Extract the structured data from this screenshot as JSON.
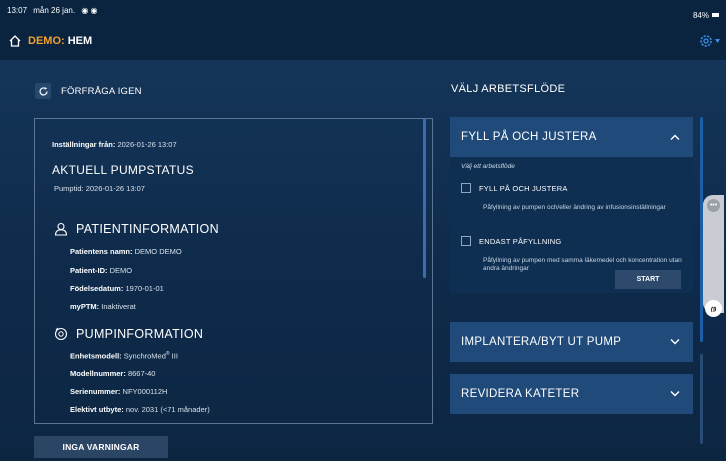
{
  "status_bar": {
    "time": "13:07",
    "date": "mån 26 jan.",
    "battery": "84%"
  },
  "header": {
    "demo": "DEMO:",
    "title": "HEM"
  },
  "refresh": {
    "label": "FÖRFRÅGA IGEN"
  },
  "status": {
    "settings_from_label": "Inställningar från:",
    "settings_from_value": "2026-01-26 13:07",
    "heading": "AKTUELL PUMPSTATUS",
    "pump_time_label": "Pumptid:",
    "pump_time_value": "2026-01-26 13:07"
  },
  "patient": {
    "heading": "PATIENTINFORMATION",
    "name_label": "Patientens namn:",
    "name_value": "DEMO DEMO",
    "id_label": "Patient-ID:",
    "id_value": "DEMO",
    "dob_label": "Födelsedatum:",
    "dob_value": "1970-01-01",
    "myptm_label": "myPTM:",
    "myptm_value": "Inaktiverat"
  },
  "pump": {
    "heading": "PUMPINFORMATION",
    "device_label": "Enhetsmodell:",
    "device_value": "SynchroMed",
    "device_mark": "®",
    "device_suffix": " III",
    "model_label": "Modellnummer:",
    "model_value": "8667-40",
    "serial_label": "Serienummer:",
    "serial_value": "NFY000112H",
    "elective_label": "Elektivt utbyte:",
    "elective_value": "nov. 2031 (<71 månader)"
  },
  "no_warnings_label": "INGA VARNINGAR",
  "workflow": {
    "title": "VÄLJ ARBETSFLÖDE",
    "sections": [
      {
        "label": "FYLL PÅ OCH JUSTERA",
        "expanded": true,
        "subtitle": "Välj ett arbetsflöde",
        "options": [
          {
            "label": "FYLL PÅ OCH JUSTERA",
            "checked": false,
            "description": "Påfyllning av pumpen och/eller ändring av infusionsinställningar"
          },
          {
            "label": "ENDAST PÅFYLLNING",
            "checked": false,
            "description": "Påfyllning av pumpen med samma läkemedel och koncentration utan andra ändringar"
          }
        ],
        "start_label": "START"
      },
      {
        "label": "IMPLANTERA/BYT UT PUMP",
        "expanded": false
      },
      {
        "label": "REVIDERA KATETER",
        "expanded": false
      }
    ]
  },
  "colors": {
    "background": "#0a2440",
    "accent_demo": "#f0a030",
    "section_header": "#1f4a7a",
    "scrollbar": "#1d5ea8"
  },
  "icons": {
    "home": "home-icon",
    "settings": "gear-icon",
    "refresh": "refresh-icon",
    "patient": "person-icon",
    "pump": "pump-icon",
    "collapse": "chevron-up-icon",
    "expand": "chevron-down-icon"
  }
}
